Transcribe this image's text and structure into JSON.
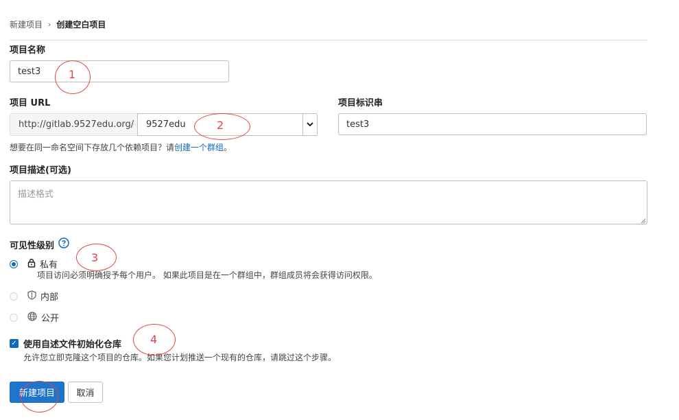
{
  "breadcrumb": {
    "parent": "新建项目",
    "separator": "›",
    "current": "创建空白项目"
  },
  "project_name": {
    "label": "项目名称",
    "value": "test3"
  },
  "project_url": {
    "label": "项目 URL",
    "prefix": "http://gitlab.9527edu.org/",
    "namespace": "9527edu"
  },
  "project_slug": {
    "label": "项目标识串",
    "value": "test3"
  },
  "url_help": {
    "text": "想要在同一命名空间下存放几个依赖项目？请",
    "link": "创建一个群组",
    "suffix": "。"
  },
  "description": {
    "label": "项目描述(可选)",
    "placeholder": "描述格式"
  },
  "visibility": {
    "label": "可见性级别",
    "options": [
      {
        "label": "私有",
        "icon": "lock-icon",
        "selected": true,
        "description": "项目访问必须明确授予每个用户。 如果此项目是在一个群组中，群组成员将会获得访问权限。"
      },
      {
        "label": "内部",
        "icon": "shield-icon",
        "selected": false
      },
      {
        "label": "公开",
        "icon": "globe-icon",
        "selected": false
      }
    ]
  },
  "init_readme": {
    "label": "使用自述文件初始化仓库",
    "checked": true,
    "description": "允许您立即克隆这个项目的仓库。如果您计划推送一个现有的仓库，请跳过这个步骤。"
  },
  "actions": {
    "create": "新建项目",
    "cancel": "取消"
  },
  "annotations": {
    "n1": "1",
    "n2": "2",
    "n3": "3",
    "n4": "4"
  },
  "colors": {
    "accent": "#1068bf",
    "primary_button": "#1f75cb",
    "annotation": "#e04545"
  }
}
